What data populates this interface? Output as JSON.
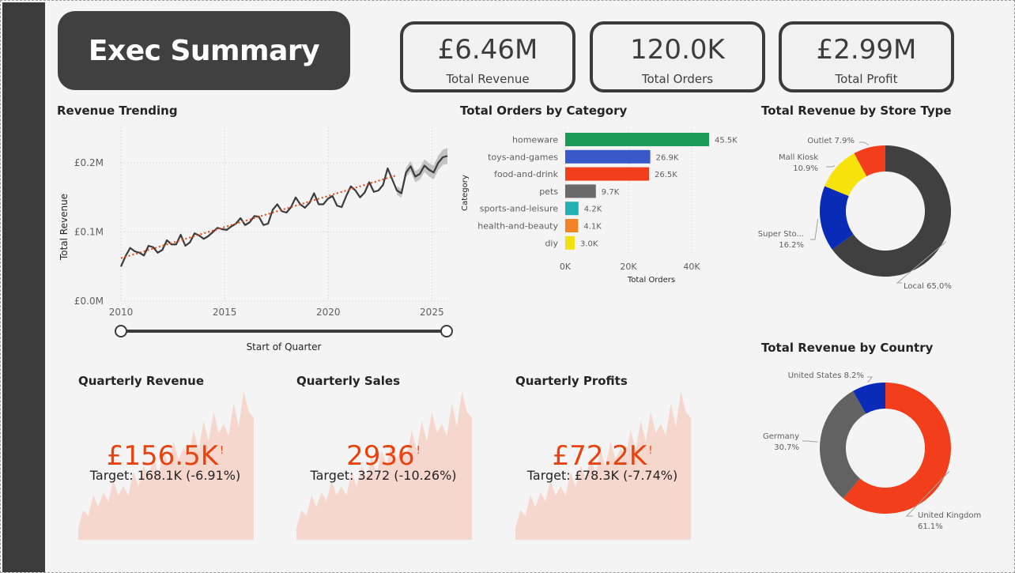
{
  "header": {
    "title": "Exec Summary"
  },
  "cards": [
    {
      "value": "£6.46M",
      "label": "Total Revenue"
    },
    {
      "value": "120.0K",
      "label": "Total Orders"
    },
    {
      "value": "£2.99M",
      "label": "Total Profit"
    }
  ],
  "revenue_trending": {
    "title": "Revenue Trending",
    "slider_label": "Start of Quarter",
    "chart_data": {
      "type": "line",
      "ylabel": "Total Revenue",
      "xlabel": "Start of Quarter",
      "y_ticks": [
        "£0.0M",
        "£0.1M",
        "£0.2M"
      ],
      "x_ticks": [
        "2010",
        "2015",
        "2020",
        "2025"
      ],
      "ylim": [
        0,
        0.2
      ],
      "xlim": [
        2010,
        2025.75
      ],
      "series": [
        {
          "values": [
            0.05,
            0.065,
            0.077,
            0.072,
            0.07,
            0.066,
            0.08,
            0.078,
            0.07,
            0.074,
            0.088,
            0.082,
            0.082,
            0.096,
            0.08,
            0.085,
            0.098,
            0.095,
            0.09,
            0.094,
            0.1,
            0.106,
            0.104,
            0.103,
            0.108,
            0.112,
            0.12,
            0.11,
            0.114,
            0.123,
            0.122,
            0.11,
            0.112,
            0.132,
            0.14,
            0.13,
            0.128,
            0.136,
            0.15,
            0.14,
            0.135,
            0.142,
            0.156,
            0.14,
            0.14,
            0.148,
            0.152,
            0.138,
            0.136,
            0.152,
            0.166,
            0.16,
            0.15,
            0.157,
            0.172,
            0.158,
            0.16,
            0.168,
            0.192,
            0.176,
            0.16,
            0.156,
            0.186,
            0.195,
            0.18,
            0.184,
            0.196,
            0.19,
            0.186,
            0.2,
            0.208,
            0.21
          ]
        },
        {
          "name": "trend",
          "values": [
            0.062,
            0.204
          ]
        }
      ],
      "forecast_from": 2023.25,
      "grid": true
    }
  },
  "orders_by_category": {
    "title": "Total Orders by Category",
    "chart_data": {
      "type": "bar",
      "orientation": "horizontal",
      "ylabel": "Category",
      "xlabel": "Total Orders",
      "categories": [
        "homeware",
        "toys-and-games",
        "food-and-drink",
        "pets",
        "sports-and-leisure",
        "health-and-beauty",
        "diy"
      ],
      "values": [
        45500,
        26900,
        26500,
        9700,
        4200,
        4100,
        3000
      ],
      "data_labels": [
        "45.5K",
        "26.9K",
        "26.5K",
        "9.7K",
        "4.2K",
        "4.1K",
        "3.0K"
      ],
      "colors": [
        "#1a9b56",
        "#3a58c9",
        "#f23e1a",
        "#6a6a6a",
        "#20b2b3",
        "#f08427",
        "#f2e10e"
      ],
      "x_ticks": [
        "0K",
        "20K",
        "40K"
      ],
      "xlim": [
        0,
        50000
      ],
      "grid": true
    }
  },
  "revenue_by_store": {
    "title": "Total Revenue by Store Type",
    "chart_data": {
      "type": "pie",
      "donut": true,
      "labels": [
        "Local",
        "Super Sto...",
        "Mall Kiosk",
        "Outlet"
      ],
      "values": [
        65.0,
        16.2,
        10.9,
        7.9
      ],
      "value_labels": [
        "65.0%",
        "16.2%",
        "10.9%",
        "7.9%"
      ],
      "colors": [
        "#404040",
        "#0a2bb8",
        "#f8e20c",
        "#f23e1a"
      ]
    }
  },
  "revenue_by_country": {
    "title": "Total Revenue by Country",
    "chart_data": {
      "type": "pie",
      "donut": true,
      "labels": [
        "United Kingdom",
        "Germany",
        "United States"
      ],
      "values": [
        61.1,
        30.7,
        8.2
      ],
      "value_labels": [
        "61.1%",
        "30.7%",
        "8.2%"
      ],
      "colors": [
        "#f23e1a",
        "#626262",
        "#0a2bb8"
      ]
    }
  },
  "kpis": [
    {
      "title": "Quarterly Revenue",
      "value": "£156.5K",
      "indicator": "!",
      "target": "Target: 168.1K (-6.91%)"
    },
    {
      "title": "Quarterly Sales",
      "value": "2936",
      "indicator": "!",
      "target": "Target: 3272 (-10.26%)"
    },
    {
      "title": "Quarterly Profits",
      "value": "£72.2K",
      "indicator": "!",
      "target": "Target: £78.3K (-7.74%)"
    }
  ],
  "kpi_trend": [
    0.08,
    0.2,
    0.16,
    0.3,
    0.22,
    0.32,
    0.26,
    0.4,
    0.3,
    0.36,
    0.3,
    0.46,
    0.36,
    0.5,
    0.42,
    0.56,
    0.44,
    0.6,
    0.5,
    0.66,
    0.54,
    0.62,
    0.56,
    0.74,
    0.6,
    0.8,
    0.66,
    0.86,
    0.72,
    0.78,
    0.7,
    0.92,
    0.76,
    1.0,
    0.86,
    0.82
  ],
  "colors": {
    "kpi_value": "#e8420f",
    "kpi_area": "#f6d7ce",
    "dark": "#404040"
  }
}
